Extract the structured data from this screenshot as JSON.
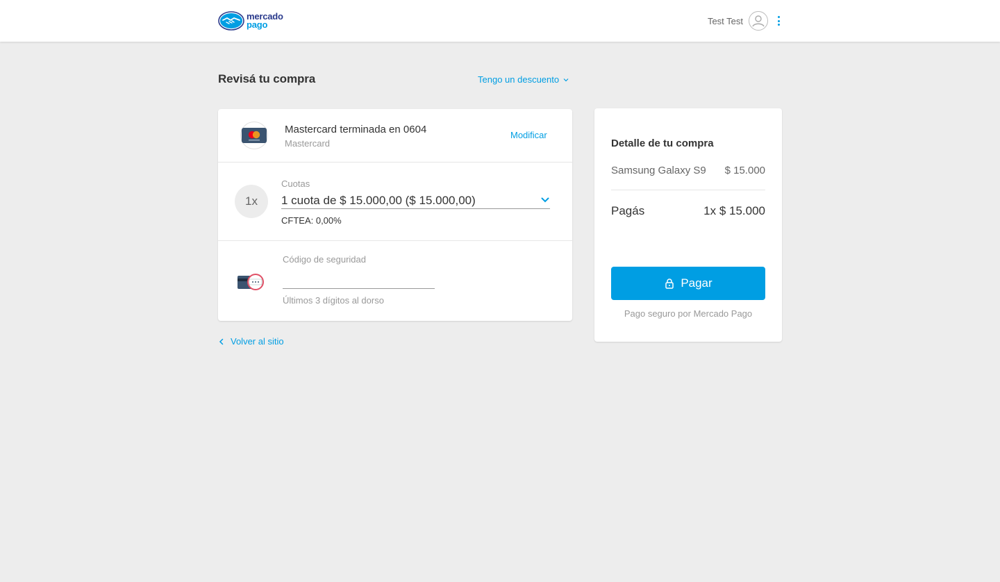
{
  "header": {
    "logo_line1": "mercado",
    "logo_line2": "pago",
    "username": "Test Test"
  },
  "page": {
    "title": "Revisá tu compra",
    "discount_link": "Tengo un descuento"
  },
  "payment_method": {
    "title": "Mastercard terminada en 0604",
    "brand": "Mastercard",
    "modify_label": "Modificar"
  },
  "installments": {
    "badge": "1x",
    "label": "Cuotas",
    "selected": "1 cuota de $ 15.000,00 ($ 15.000,00)",
    "cftea": "CFTEA: 0,00%"
  },
  "security_code": {
    "label": "Código de seguridad",
    "value": "",
    "hint": "Últimos 3 dígitos al dorso"
  },
  "back_link": "Volver al sitio",
  "summary": {
    "title": "Detalle de tu compra",
    "item_name": "Samsung Galaxy S9",
    "item_price": "$ 15.000",
    "total_label": "Pagás",
    "total_value": "1x $ 15.000",
    "pay_button": "Pagar",
    "secure_note": "Pago seguro por Mercado Pago"
  },
  "colors": {
    "accent": "#009ee3",
    "brand_dark": "#2a3a8c",
    "background": "#ededed"
  },
  "icons": {
    "logo": "handshake-icon",
    "avatar": "user-icon",
    "menu": "kebab-menu-icon",
    "discount": "chevron-down-icon",
    "card_brand": "mastercard-icon",
    "select": "chevron-down-icon",
    "cvv": "card-cvv-icon",
    "back": "chevron-left-icon",
    "lock": "lock-icon"
  }
}
